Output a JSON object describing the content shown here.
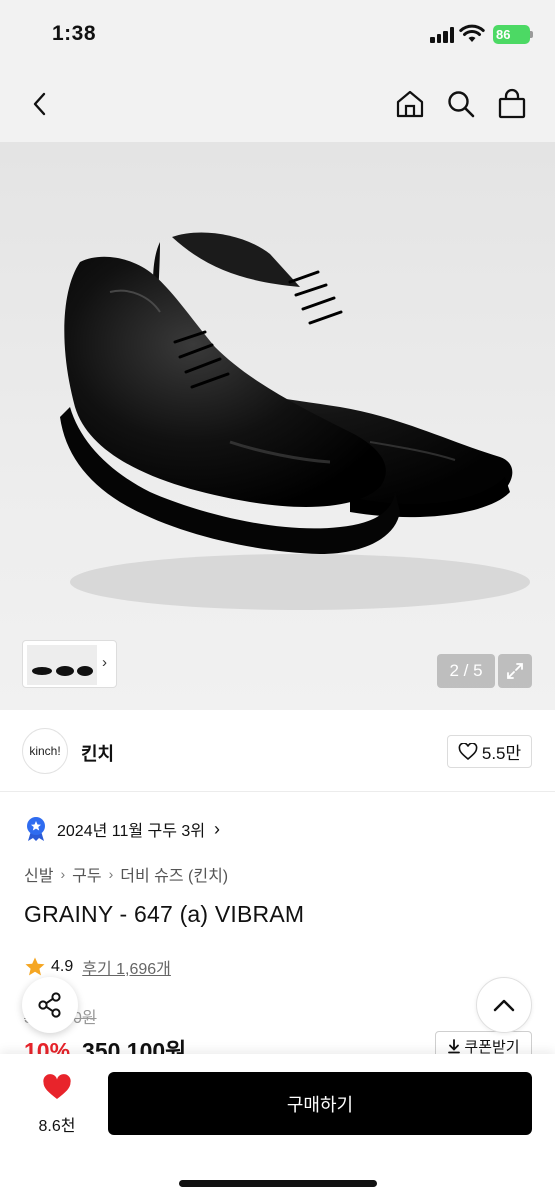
{
  "status_bar": {
    "time": "1:38",
    "battery": "86"
  },
  "nav": {
    "back_icon": "chevron-left-icon",
    "home_icon": "home-icon",
    "search_icon": "search-icon",
    "cart_icon": "shopping-bag-icon"
  },
  "gallery": {
    "page_indicator": "2 / 5",
    "current_page": 2,
    "total_pages": 5
  },
  "shop": {
    "logo_text": "kinch!",
    "name": "킨치",
    "likes": "5.5만"
  },
  "ranking": {
    "text": "2024년 11월 구두 3위"
  },
  "breadcrumb": [
    "신발",
    "구두",
    "더비 슈즈 (킨치)"
  ],
  "product": {
    "title": "GRAINY - 647 (a) VIBRAM",
    "rating": "4.9",
    "reviews": "후기 1,696개",
    "original_price": "390,000원",
    "discount": "10%",
    "price": "350,100원",
    "coupon_label": "쿠폰받기"
  },
  "bottom": {
    "wish_count": "8.6천",
    "buy_label": "구매하기"
  },
  "colors": {
    "accent_red": "#e8242b",
    "buy_button": "#000000",
    "battery_green": "#4cd964",
    "star": "#f5a623"
  }
}
